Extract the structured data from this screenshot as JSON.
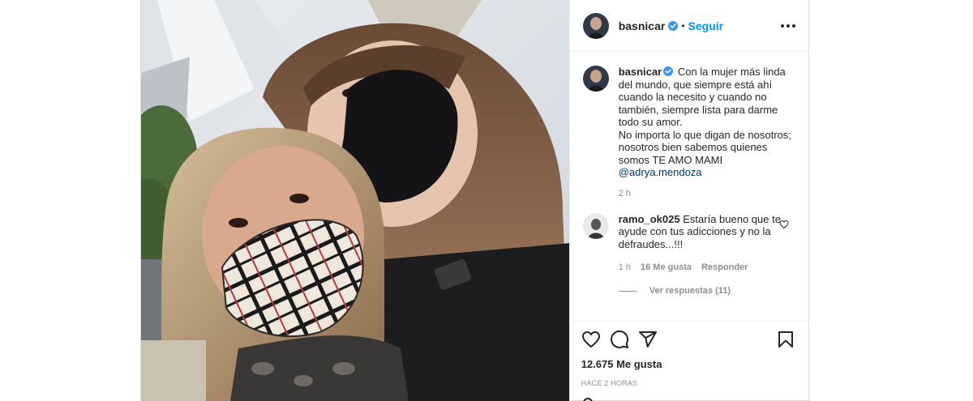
{
  "post": {
    "username": "basnicar",
    "follow_label": "Seguir",
    "separator": "•",
    "caption": {
      "username": "basnicar",
      "text_line1": "Con la mujer más linda del mundo, que siempre está ahí cuando la necesito y cuando no también, siempre lista para darme todo su amor.",
      "text_line2": "No importa lo que digan de nosotros; nosotros bien sabemos quienes somos TE AMO MAMI",
      "mention": "@adrya.mendoza",
      "time": "2 h"
    },
    "comment": {
      "username": "ramo_ok025",
      "text": "Estaría bueno que te ayude con tus adicciones y no la defraudes...!!!",
      "time": "1 h",
      "likes": "16 Me gusta",
      "reply_label": "Responder",
      "view_replies": "Ver respuestas (11)"
    },
    "likes_count": "12.675 Me gusta",
    "posted_ago": "HACE 2 HORAS",
    "icons": {
      "like": "heart-icon",
      "comment": "comment-icon",
      "share": "share-icon",
      "save": "bookmark-icon",
      "more": "more-options-icon",
      "verified": "verified-badge-icon"
    },
    "colors": {
      "follow": "#0095f6",
      "verified": "#3897f0",
      "mention": "#00376b",
      "muted": "#8e8e8e"
    }
  }
}
